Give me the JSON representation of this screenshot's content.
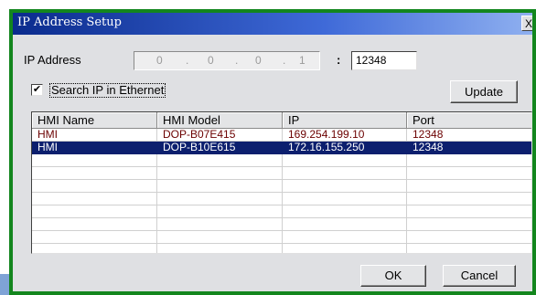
{
  "dialog": {
    "title": "IP Address Setup",
    "close_label": "X"
  },
  "ip": {
    "label": "IP Address",
    "octets": [
      "0",
      "0",
      "0",
      "1"
    ],
    "dot": ".",
    "colon": ":",
    "port": "12348"
  },
  "search": {
    "checked_mark": "✔",
    "label": "Search IP in Ethernet"
  },
  "buttons": {
    "update": "Update",
    "ok": "OK",
    "cancel": "Cancel"
  },
  "table": {
    "columns": [
      "HMI Name",
      "HMI Model",
      "IP",
      "Port"
    ],
    "rows": [
      [
        "HMI",
        "DOP-B07E415",
        "169.254.199.10",
        "12348"
      ],
      [
        "HMI",
        "DOP-B10E615",
        "172.16.155.250",
        "12348"
      ]
    ],
    "selected_row": 1
  },
  "colors": {
    "dialog_border": "#13861e",
    "title_bar": "#0a2b8d",
    "selection": "#0c1f6e",
    "row_text": "#6b0000"
  }
}
